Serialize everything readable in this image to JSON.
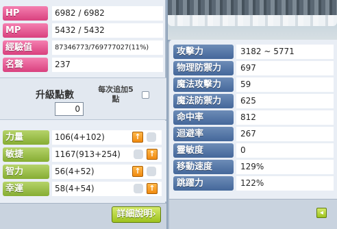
{
  "left_panel": {
    "stats": [
      {
        "label": "HP",
        "value": "6982 / 6982"
      },
      {
        "label": "MP",
        "value": "5432 / 5432"
      },
      {
        "label": "經驗值",
        "value": "87346773/769777027(11%)"
      },
      {
        "label": "名聲",
        "value": "237"
      }
    ],
    "ap": {
      "label": "升級點數",
      "value": "0",
      "note": "每次追加5點"
    },
    "attributes": [
      {
        "label": "力量",
        "value": "106(4+102)"
      },
      {
        "label": "敏捷",
        "value": "1167(913+254)"
      },
      {
        "label": "智力",
        "value": "56(4+52)"
      },
      {
        "label": "幸運",
        "value": "58(4+54)"
      }
    ],
    "detail_button": "詳細說明",
    "up_icon": "arrow-up-icon"
  },
  "right_panel": {
    "stats": [
      {
        "label": "攻擊力",
        "value": "3182 ~ 5771"
      },
      {
        "label": "物理防禦力",
        "value": "697"
      },
      {
        "label": "魔法攻擊力",
        "value": "59"
      },
      {
        "label": "魔法防禦力",
        "value": "625"
      },
      {
        "label": "命中率",
        "value": "812"
      },
      {
        "label": "迴避率",
        "value": "267"
      },
      {
        "label": "靈敏度",
        "value": "0"
      },
      {
        "label": "移動速度",
        "value": "129%"
      },
      {
        "label": "跳躍力",
        "value": "122%"
      }
    ],
    "collapse_icon": "arrow-left-icon"
  },
  "colors": {
    "primary_stat_label": "#d9407e",
    "attribute_label": "#86ad33",
    "detail_stat_label": "#44679a",
    "up_button": "#f08a10"
  }
}
